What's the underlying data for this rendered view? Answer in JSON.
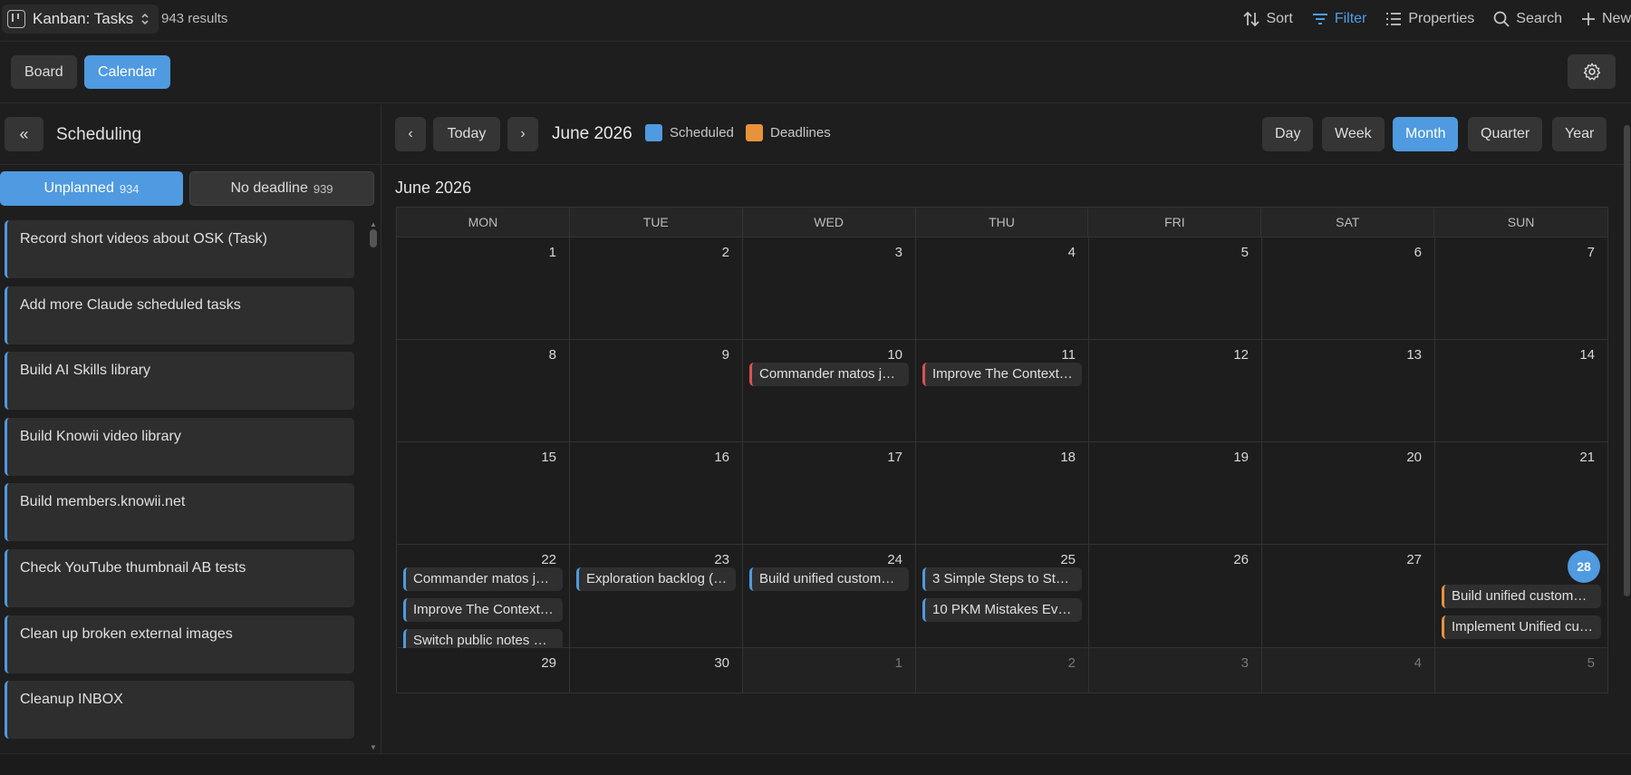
{
  "topbar": {
    "view_name": "Kanban: Tasks",
    "results": "943 results",
    "tools": [
      {
        "label": "Sort",
        "icon": "sort-icon"
      },
      {
        "label": "Filter",
        "icon": "filter-icon",
        "active": true
      },
      {
        "label": "Properties",
        "icon": "list-icon"
      },
      {
        "label": "Search",
        "icon": "search-icon"
      },
      {
        "label": "New",
        "icon": "plus-icon"
      }
    ]
  },
  "view_tabs": [
    {
      "label": "Board",
      "active": false
    },
    {
      "label": "Calendar",
      "active": true
    }
  ],
  "sidebar": {
    "collapse_label": "«",
    "title": "Scheduling",
    "segments": [
      {
        "label": "Unplanned",
        "count": "934",
        "active": true
      },
      {
        "label": "No deadline",
        "count": "939",
        "active": false
      }
    ],
    "tasks": [
      "Record short videos about OSK (Task)",
      "Add more Claude scheduled tasks",
      "Build AI Skills library",
      "Build Knowii video library",
      "Build members.knowii.net",
      "Check YouTube thumbnail AB tests",
      "Clean up broken external images",
      "Cleanup INBOX"
    ]
  },
  "calendar": {
    "prev_label": "‹",
    "today_label": "Today",
    "next_label": "›",
    "title": "June 2026",
    "legend": [
      {
        "label": "Scheduled",
        "color": "#4f9ae0"
      },
      {
        "label": "Deadlines",
        "color": "#e8923a"
      }
    ],
    "ranges": [
      {
        "label": "Day",
        "active": false
      },
      {
        "label": "Week",
        "active": false
      },
      {
        "label": "Month",
        "active": true
      },
      {
        "label": "Quarter",
        "active": false
      },
      {
        "label": "Year",
        "active": false
      }
    ],
    "month_label": "June 2026",
    "days_of_week": [
      "MON",
      "TUE",
      "WED",
      "THU",
      "FRI",
      "SAT",
      "SUN"
    ],
    "weeks": [
      [
        {
          "n": "1"
        },
        {
          "n": "2"
        },
        {
          "n": "3"
        },
        {
          "n": "4"
        },
        {
          "n": "5"
        },
        {
          "n": "6"
        },
        {
          "n": "7"
        }
      ],
      [
        {
          "n": "8"
        },
        {
          "n": "9"
        },
        {
          "n": "10",
          "events": [
            {
              "t": "Commander matos jeux",
              "c": "red"
            }
          ]
        },
        {
          "n": "11",
          "events": [
            {
              "t": "Improve The Context …",
              "c": "red"
            }
          ]
        },
        {
          "n": "12"
        },
        {
          "n": "13"
        },
        {
          "n": "14"
        }
      ],
      [
        {
          "n": "15"
        },
        {
          "n": "16"
        },
        {
          "n": "17"
        },
        {
          "n": "18"
        },
        {
          "n": "19"
        },
        {
          "n": "20"
        },
        {
          "n": "21"
        }
      ],
      [
        {
          "n": "22",
          "events": [
            {
              "t": "Commander matos jeux",
              "c": "blue"
            },
            {
              "t": "Improve The Context …",
              "c": "blue"
            },
            {
              "t": "Switch public notes w…",
              "c": "blue"
            }
          ]
        },
        {
          "n": "23",
          "events": [
            {
              "t": "Exploration backlog (…",
              "c": "blue"
            }
          ]
        },
        {
          "n": "24",
          "events": [
            {
              "t": "Build unified custome…",
              "c": "blue"
            }
          ]
        },
        {
          "n": "25",
          "events": [
            {
              "t": "3 Simple Steps to Sto…",
              "c": "blue"
            },
            {
              "t": "10 PKM Mistakes Ev…",
              "c": "blue"
            }
          ]
        },
        {
          "n": "26"
        },
        {
          "n": "27"
        },
        {
          "n": "28",
          "today": true,
          "events": [
            {
              "t": "Build unified custome…",
              "c": "orange"
            },
            {
              "t": "Implement Unified cu…",
              "c": "orange"
            }
          ]
        }
      ],
      [
        {
          "n": "29"
        },
        {
          "n": "30"
        },
        {
          "n": "1",
          "other": true
        },
        {
          "n": "2",
          "other": true
        },
        {
          "n": "3",
          "other": true
        },
        {
          "n": "4",
          "other": true
        },
        {
          "n": "5",
          "other": true
        }
      ]
    ]
  }
}
